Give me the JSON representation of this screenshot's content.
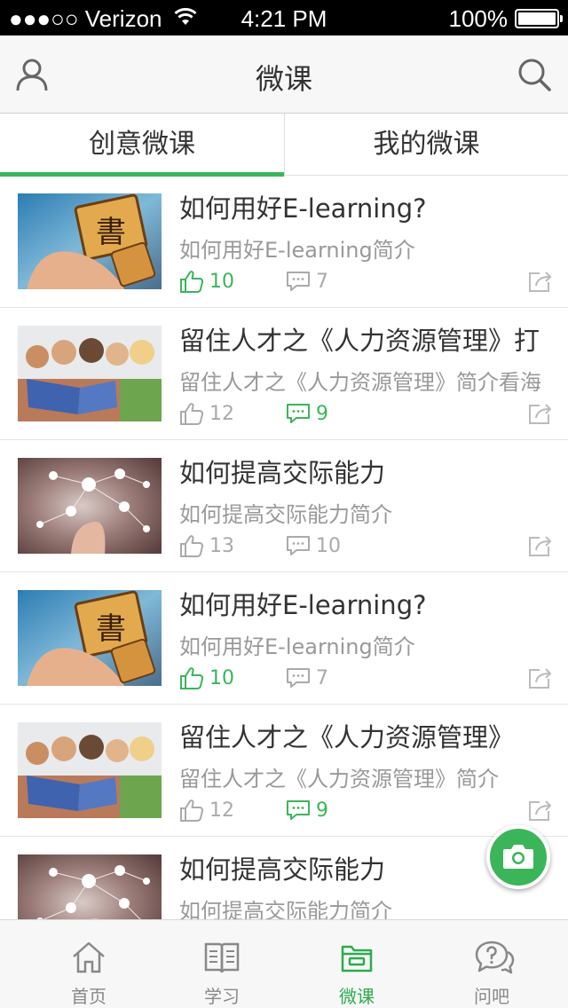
{
  "status_bar": {
    "signal": "●●●○○",
    "carrier": "Verizon",
    "time": "4:21 PM",
    "battery": "100%"
  },
  "header": {
    "title": "微课",
    "left_icon": "user-icon",
    "right_icon": "search-icon"
  },
  "tabs": [
    {
      "label": "创意微课",
      "active": true
    },
    {
      "label": "我的微课",
      "active": false
    }
  ],
  "courses": [
    {
      "title": "如何用好E-learning?",
      "description": "如何用好E-learning简介",
      "likes": "10",
      "comments": "7",
      "liked": true,
      "commented": false,
      "thumbnail": "keyboard-thumbnail"
    },
    {
      "title": "留住人才之《人力资源管理》打",
      "description": "留住人才之《人力资源管理》简介看海",
      "likes": "12",
      "comments": "9",
      "liked": false,
      "commented": true,
      "thumbnail": "students-thumbnail"
    },
    {
      "title": "如何提高交际能力",
      "description": "如何提高交际能力简介",
      "likes": "13",
      "comments": "10",
      "liked": false,
      "commented": false,
      "thumbnail": "network-thumbnail"
    },
    {
      "title": "如何用好E-learning?",
      "description": "如何用好E-learning简介",
      "likes": "10",
      "comments": "7",
      "liked": true,
      "commented": false,
      "thumbnail": "keyboard-thumbnail"
    },
    {
      "title": "留住人才之《人力资源管理》",
      "description": "留住人才之《人力资源管理》简介",
      "likes": "12",
      "comments": "9",
      "liked": false,
      "commented": true,
      "thumbnail": "students-thumbnail"
    },
    {
      "title": "如何提高交际能力",
      "description": "如何提高交际能力简介",
      "likes": "",
      "comments": "",
      "liked": false,
      "commented": false,
      "thumbnail": "network-thumbnail"
    }
  ],
  "fab": {
    "icon": "camera-icon"
  },
  "bottom_tabs": [
    {
      "label": "首页",
      "icon": "home-icon",
      "active": false
    },
    {
      "label": "学习",
      "icon": "book-icon",
      "active": false
    },
    {
      "label": "微课",
      "icon": "briefcase-icon",
      "active": true
    },
    {
      "label": "问吧",
      "icon": "question-chat-icon",
      "active": false
    }
  ],
  "colors": {
    "accent": "#3bb55a",
    "text_primary": "#333333",
    "text_secondary": "#999999"
  }
}
